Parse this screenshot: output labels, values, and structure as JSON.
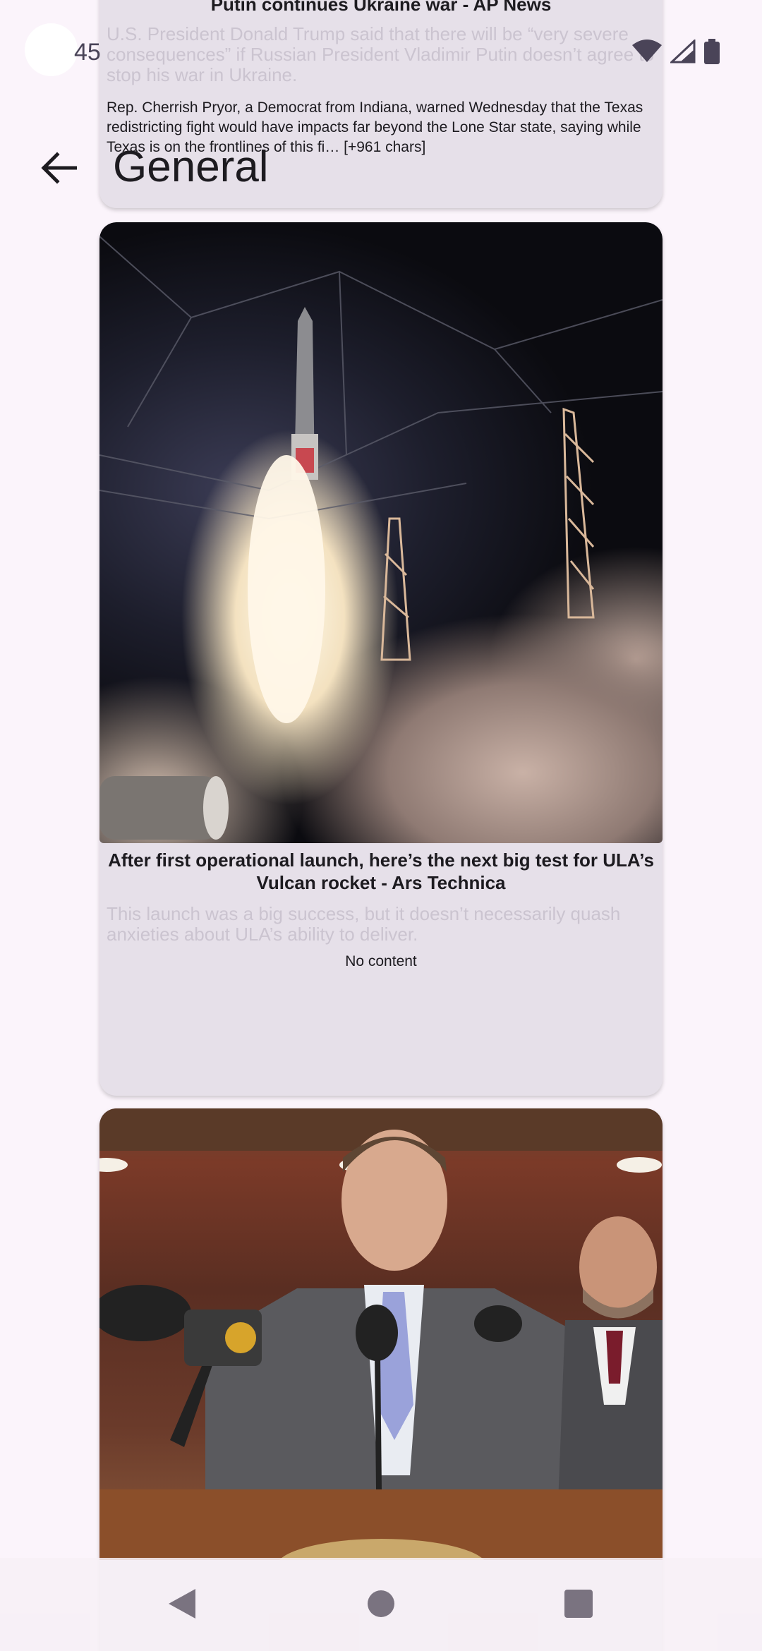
{
  "status_bar": {
    "time": "45",
    "icons": [
      "wifi-icon",
      "signal-icon",
      "battery-icon"
    ]
  },
  "app_bar": {
    "title": "General",
    "back_icon": "arrow-back-icon"
  },
  "articles": [
    {
      "title": "Putin continues Ukraine war - AP News",
      "description": "U.S. President Donald Trump said that there will be “very severe consequences” if Russian President Vladimir Putin doesn’t agree to stop his war in Ukraine.",
      "content": "Rep. Cherrish Pryor, a Democrat from Indiana, warned Wednesday that the Texas redistricting fight would have impacts far beyond the Lone Star state, saying while Texas is on the frontlines of this fi… [+961 chars]"
    },
    {
      "title": "After first operational launch, here’s the next big test for ULA’s Vulcan rocket - Ars Technica",
      "description": "This launch was a big success, but it doesn’t necessarily quash anxieties about ULA’s ability to deliver.",
      "content": "No content"
    }
  ],
  "nav_bar": {
    "back": "triangle-back-icon",
    "home": "circle-home-icon",
    "recents": "square-recents-icon"
  },
  "colors": {
    "background": "#fbf4fb",
    "card": "#e6e0e9",
    "text": "#1d1b20",
    "faded_text": "#cbc4d0"
  }
}
